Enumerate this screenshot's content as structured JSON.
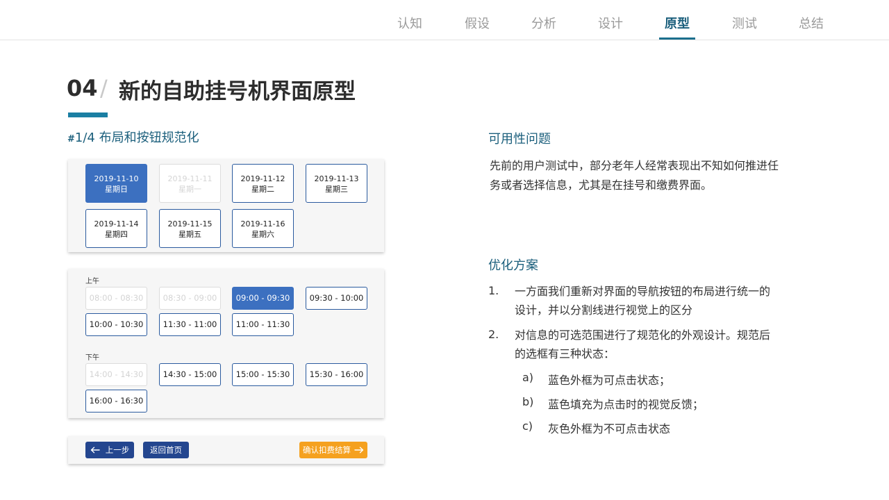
{
  "nav": {
    "items": [
      {
        "label": "认知"
      },
      {
        "label": "假设"
      },
      {
        "label": "分析"
      },
      {
        "label": "设计"
      },
      {
        "label": "原型"
      },
      {
        "label": "测试"
      },
      {
        "label": "总结"
      }
    ],
    "active": "原型"
  },
  "header": {
    "number": "04",
    "slash": "/",
    "title": "新的自助挂号机界面原型"
  },
  "subtitle": {
    "hash": "#",
    "text": "1/4 布局和按钮规范化"
  },
  "dates": [
    {
      "date": "2019-11-10",
      "weekday": "星期日",
      "state": "selected"
    },
    {
      "date": "2019-11-11",
      "weekday": "星期一",
      "state": "disabled"
    },
    {
      "date": "2019-11-12",
      "weekday": "星期二",
      "state": "available"
    },
    {
      "date": "2019-11-13",
      "weekday": "星期三",
      "state": "available"
    },
    {
      "date": "2019-11-14",
      "weekday": "星期四",
      "state": "available"
    },
    {
      "date": "2019-11-15",
      "weekday": "星期五",
      "state": "available"
    },
    {
      "date": "2019-11-16",
      "weekday": "星期六",
      "state": "available"
    }
  ],
  "morning": {
    "label": "上午",
    "slots": [
      {
        "time": "08:00 - 08:30",
        "state": "disabled"
      },
      {
        "time": "08:30 - 09:00",
        "state": "disabled"
      },
      {
        "time": "09:00 - 09:30",
        "state": "selected"
      },
      {
        "time": "09:30 - 10:00",
        "state": "available"
      },
      {
        "time": "10:00 - 10:30",
        "state": "available"
      },
      {
        "time": "11:30 - 11:00",
        "state": "available"
      },
      {
        "time": "11:00 - 11:30",
        "state": "available"
      }
    ]
  },
  "afternoon": {
    "label": "下午",
    "slots": [
      {
        "time": "14:00 - 14:30",
        "state": "disabled"
      },
      {
        "time": "14:30 - 15:00",
        "state": "available"
      },
      {
        "time": "15:00 - 15:30",
        "state": "available"
      },
      {
        "time": "15:30 - 16:00",
        "state": "available"
      },
      {
        "time": "16:00 - 16:30",
        "state": "available"
      }
    ]
  },
  "buttons": {
    "prev": "上一步",
    "home": "返回首页",
    "confirm": "确认扣费结算"
  },
  "usability": {
    "heading": "可用性问题",
    "text": "先前的用户测试中，部分老年人经常表现出不知如何推进任务或者选择信息，尤其是在挂号和缴费界面。"
  },
  "solution": {
    "heading": "优化方案",
    "items": [
      {
        "num": "1.",
        "text": "一方面我们重新对界面的导航按钮的布局进行统一的设计，并以分割线进行视觉上的区分"
      },
      {
        "num": "2.",
        "text": "对信息的可选范围进行了规范化的外观设计。规范后的选框有三种状态："
      }
    ],
    "subitems": [
      {
        "num": "a)",
        "text": "蓝色外框为可点击状态；"
      },
      {
        "num": "b)",
        "text": "蓝色填充为点击时的视觉反馈；"
      },
      {
        "num": "c)",
        "text": "灰色外框为不可点击状态"
      }
    ]
  },
  "colors": {
    "accent": "#1b6f8d",
    "selected_fill": "#3c70c0",
    "cell_border": "#2a5a9e",
    "button_dark": "#24468f",
    "button_confirm": "#f5a11f"
  }
}
